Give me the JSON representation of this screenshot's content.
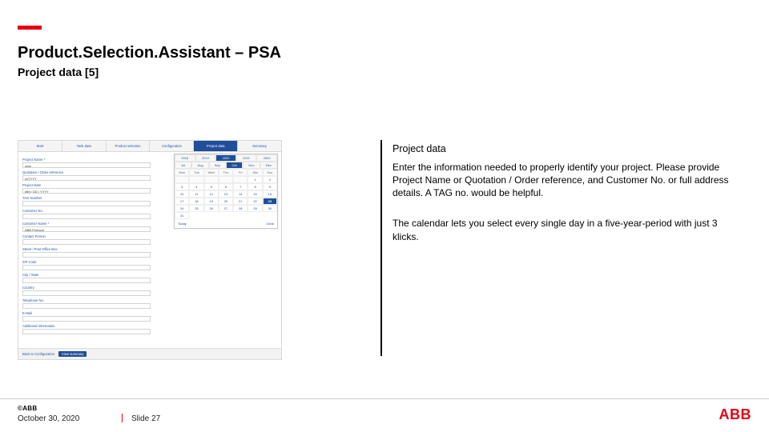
{
  "header": {
    "title": "Product.Selection.Assistant – PSA",
    "subtitle": "Project data [5]"
  },
  "right": {
    "heading": "Project data",
    "para1": "Enter the information needed to properly identify your project. Please provide Project Name or Quotation / Order reference, and Customer No. or full address details. A TAG no. would be helpful.",
    "para2": "The calendar lets you select every single day in a five-year-period with just 3 klicks."
  },
  "footer": {
    "copyright": "©ABB",
    "date": "October 30, 2020",
    "slide": "Slide 27",
    "logoText": "ABB"
  },
  "shot": {
    "tabs": [
      "Start",
      "Tank data",
      "Product selection",
      "Configuration",
      "Project data",
      "Summary"
    ],
    "activeTabIndex": 4,
    "fields": [
      {
        "label": "Project Name *",
        "value": "xxxx"
      },
      {
        "label": "Quotation / Order reference",
        "value": "xxYYYY"
      },
      {
        "label": "Project Date",
        "value": "MM / DD / YYYY"
      },
      {
        "label": "TAG Number",
        "value": ""
      },
      {
        "label": "Customer No.",
        "value": ""
      },
      {
        "label": "Customer Name *",
        "value": "ABB Protocol"
      },
      {
        "label": "Contact Person",
        "value": ""
      },
      {
        "label": "Street / Post Office Box",
        "value": ""
      },
      {
        "label": "ZIP Code",
        "value": ""
      },
      {
        "label": "City / State",
        "value": ""
      },
      {
        "label": "Country",
        "value": ""
      },
      {
        "label": "Telephone No.",
        "value": ""
      },
      {
        "label": "E-Mail",
        "value": ""
      },
      {
        "label": "Additional Information",
        "value": ""
      }
    ],
    "picker": {
      "years": [
        "2018",
        "2019",
        "2020",
        "2021",
        "2022"
      ],
      "selectedYearIndex": 2,
      "months": [
        "Jul",
        "Aug",
        "Sep",
        "Oct",
        "Nov",
        "Dec"
      ],
      "selectedMonthIndex": 3,
      "dayHeaders": [
        "Mon",
        "Tue",
        "Wed",
        "Thu",
        "Fri",
        "Sat",
        "Sun"
      ],
      "leadingEmpty": 5,
      "daysInMonth": 31,
      "today": 23,
      "btnToday": "Today",
      "btnClear": "Clear"
    },
    "bottomBar": {
      "back": "Back to Configuration",
      "primary": "View summary"
    }
  }
}
